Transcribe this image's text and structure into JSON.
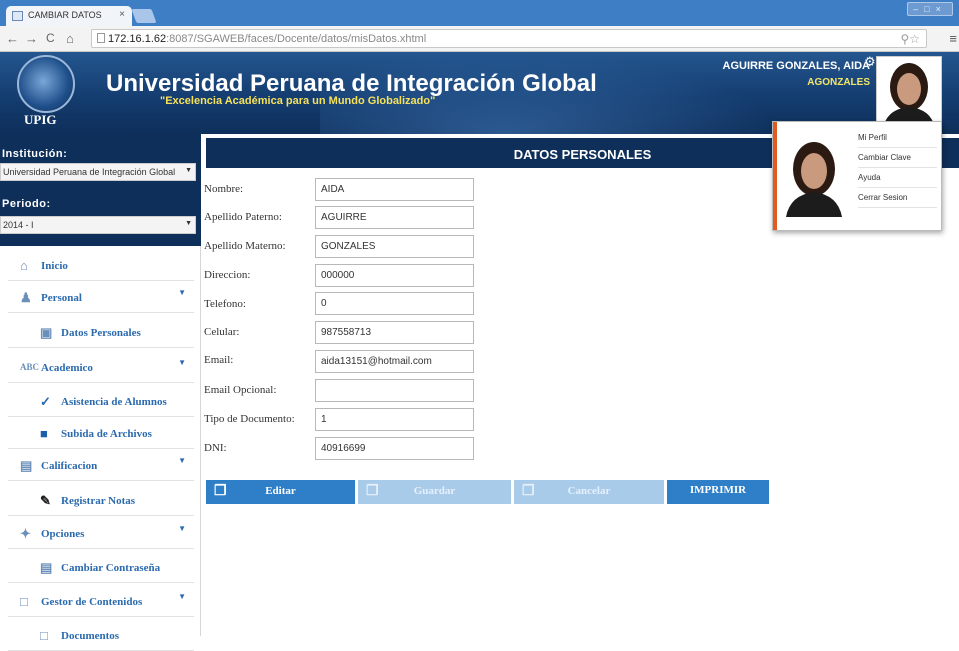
{
  "browser": {
    "tab_title": "CAMBIAR DATOS",
    "tab_close": "×",
    "url_host": "172.16.1.62",
    "url_path": ":8087/SGAWEB/faces/Docente/datos/misDatos.xhtml",
    "back_icon": "←",
    "forward_icon": "→",
    "reload_icon": "C",
    "home_icon": "⌂",
    "window_controls": "–□×"
  },
  "header": {
    "logo_text": "UPIG",
    "university_name": "Universidad Peruana de Integración Global",
    "slogan": "\"Excelencia Académica para un Mundo Globalizado\"",
    "user_full_name": "AGUIRRE GONZALES, AIDA",
    "user_login": "AGONZALES"
  },
  "sidebar": {
    "institution_label": "Institución:",
    "institution_value": "Universidad Peruana de Integración Global",
    "period_label": "Periodo:",
    "period_value": "2014 - I",
    "menu": [
      {
        "label": "Inicio",
        "icon": "home-icon"
      },
      {
        "label": "Personal",
        "icon": "person-icon"
      },
      {
        "label": "Datos Personales",
        "icon": "id-card-icon"
      },
      {
        "label": "Academico",
        "icon": "abc-icon"
      },
      {
        "label": "Asistencia de Alumnos",
        "icon": "checkmark-icon"
      },
      {
        "label": "Subida de Archivos",
        "icon": "folder-icon"
      },
      {
        "label": "Calificacion",
        "icon": "document-icon"
      },
      {
        "label": "Registrar Notas",
        "icon": "pencil-icon"
      },
      {
        "label": "Opciones",
        "icon": "wand-icon"
      },
      {
        "label": "Cambiar Contraseña",
        "icon": "printer-icon"
      },
      {
        "label": "Gestor de Contenidos",
        "icon": "page-icon"
      },
      {
        "label": "Documentos",
        "icon": "page-icon"
      }
    ]
  },
  "main": {
    "panel_title": "DATOS PERSONALES",
    "fields": [
      {
        "label": "Nombre:",
        "value": "AIDA"
      },
      {
        "label": "Apellido Paterno:",
        "value": "AGUIRRE"
      },
      {
        "label": "Apellido Materno:",
        "value": "GONZALES"
      },
      {
        "label": "Direccion:",
        "value": "000000"
      },
      {
        "label": "Telefono:",
        "value": "0"
      },
      {
        "label": "Celular:",
        "value": "987558713"
      },
      {
        "label": "Email:",
        "value": "aida13151@hotmail.com"
      },
      {
        "label": "Email Opcional:",
        "value": ""
      },
      {
        "label": "Tipo de Documento:",
        "value": "1"
      },
      {
        "label": "DNI:",
        "value": "40916699"
      }
    ],
    "buttons": {
      "edit": "Editar",
      "save": "Guardar",
      "cancel": "Cancelar",
      "print": "IMPRIMIR"
    }
  },
  "profile_menu": {
    "items": [
      "Mi Perfil",
      "Cambiar Clave",
      "Ayuda",
      "Cerrar Sesion"
    ]
  },
  "colors": {
    "navy": "#0e2f5a",
    "button_blue": "#2f7fc8",
    "button_disabled": "#a9cbea",
    "slogan_yellow": "#f6e15a",
    "dropdown_accent": "#e05a22"
  }
}
